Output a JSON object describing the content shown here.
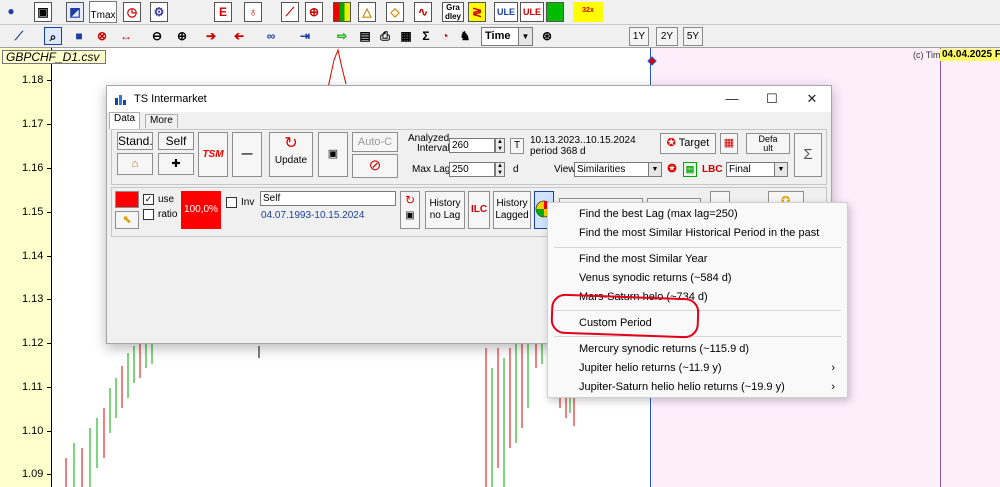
{
  "toolbar_top": {
    "tmax_label": "Tmax",
    "gradley_label": "Gra dley",
    "ule_label": "ULE",
    "ule2_label": "ULE",
    "zoom_label": "32x"
  },
  "toolbar_second": {
    "time_select": "Time",
    "range_buttons": [
      "1Y",
      "2Y",
      "5Y"
    ]
  },
  "chart": {
    "symbol_label": "GBPCHF_D1.csv",
    "y_ticks": [
      "1.18",
      "1.17",
      "1.16",
      "1.15",
      "1.14",
      "1.13",
      "1.12",
      "1.11",
      "1.10",
      "1.09"
    ],
    "top_right_label": "(c) Tim",
    "top_right_date": "04.04.2025 F",
    "colors": {
      "axis_bg": "#ffffcc",
      "future_bg": "#fdeefc",
      "up": "#00aa00",
      "down": "#dd0000"
    }
  },
  "dialog": {
    "title": "TS Intermarket",
    "tabs": [
      "Data",
      "More"
    ],
    "standard_btn": "Stand.",
    "self_btn": "Self",
    "tsm_label": "TSM",
    "minus_label": "—",
    "update_btn": "Update",
    "autoc_btn": "Auto-C",
    "analyzed_label_1": "Analyzed",
    "analyzed_label_2": "Interval",
    "analyzed_value": "260",
    "maxlag_label": "Max Lag",
    "maxlag_value": "250",
    "t_btn": "T",
    "d_label": "d",
    "date_range": "10.13.2023..10.15.2024",
    "period": "period 368 d",
    "target_btn": "Target",
    "default_btn_1": "Defa",
    "default_btn_2": "ult",
    "sigma_label": "Σ",
    "view_label": "View",
    "view_value": "Similarities",
    "lbc_label": "LBC",
    "final_value": "Final",
    "use_label": "use",
    "ratio_label": "ratio",
    "pct_label": "100,0%",
    "inv_label": "Inv",
    "self_field": "Self",
    "self_range": "04.07.1993-10.15.2024",
    "history_nolag_1": "History",
    "history_nolag_2": "no Lag",
    "ilc_label": "ILC",
    "history_lagged_1": "History",
    "history_lagged_2": "Lagged"
  },
  "context_menu": {
    "items": [
      "Find the best Lag (max lag=250)",
      "Find the most Similar Historical Period in the past",
      "Find the most Similar Year",
      "Venus synodic returns (~584 d)",
      "Mars-Saturn helo (~734 d)",
      "Custom Period",
      "Mercury synodic returns (~115.9 d)",
      "Jupiter helio returns (~11.9 y)",
      "Jupiter-Saturn helio helio returns (~19.9 y)"
    ],
    "submenu_arrow": "›"
  }
}
